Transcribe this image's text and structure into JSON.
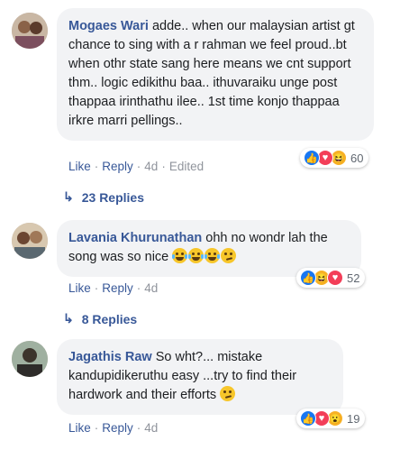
{
  "comments": [
    {
      "author": "Mogaes Wari",
      "text": "adde.. when our malaysian artist gt chance to sing with a r rahman we feel proud..bt when othr state sang here means we cnt support thm.. logic edikithu baa.. ithuvaraiku unge post thappaa irinthathu ilee.. 1st time konjo thappaa irkre marri pellings..",
      "reactions": [
        "like",
        "love",
        "haha"
      ],
      "reaction_count": "60",
      "actions": {
        "like": "Like",
        "reply": "Reply",
        "time": "4d",
        "edited": "Edited"
      },
      "replies": "23 Replies"
    },
    {
      "author": "Lavania Khurunathan",
      "text": "ohh no wondr lah the song was so nice",
      "reactions": [
        "like",
        "haha",
        "love"
      ],
      "reaction_count": "52",
      "actions": {
        "like": "Like",
        "reply": "Reply",
        "time": "4d"
      },
      "replies": "8 Replies"
    },
    {
      "author": "Jagathis Raw",
      "text": "So wht?... mistake kandupidikeruthu easy ...try to find their hardwork and their efforts",
      "reactions": [
        "like",
        "love",
        "wow"
      ],
      "reaction_count": "19",
      "actions": {
        "like": "Like",
        "reply": "Reply",
        "time": "4d"
      }
    }
  ],
  "icons": {
    "reply_arrow": "reply-arrow-icon",
    "separator": "·"
  },
  "colors": {
    "author": "#385898",
    "bubble": "#f2f3f5",
    "meta": "#90949c",
    "like": "#1877f2",
    "love": "#f33e58",
    "haha": "#f7b125"
  }
}
